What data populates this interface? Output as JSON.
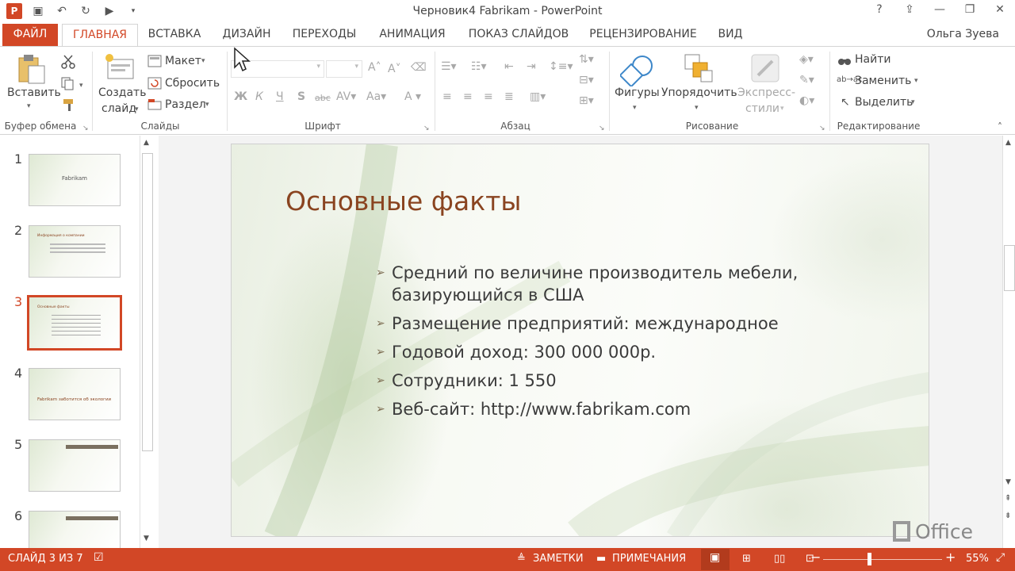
{
  "window": {
    "title": "Черновик4 Fabrikam - PowerPoint",
    "help": "?",
    "controls": [
      "ribbon-display",
      "minimize",
      "restore",
      "close"
    ]
  },
  "qat": {
    "app_icon": "P",
    "items": [
      "save-icon",
      "undo-icon",
      "redo-icon",
      "slideshow-icon",
      "customize-icon"
    ]
  },
  "tabs": [
    "ФАЙЛ",
    "ГЛАВНАЯ",
    "ВСТАВКА",
    "ДИЗАЙН",
    "ПЕРЕХОДЫ",
    "АНИМАЦИЯ",
    "ПОКАЗ СЛАЙДОВ",
    "РЕЦЕНЗИРОВАНИЕ",
    "ВИД"
  ],
  "user": "Ольга Зуева",
  "ribbon": {
    "clipboard": {
      "label": "Буфер обмена",
      "paste": "Вставить"
    },
    "slides": {
      "label": "Слайды",
      "new_slide_1": "Создать",
      "new_slide_2": "слайд",
      "layout": "Макет",
      "reset": "Сбросить",
      "section": "Раздел"
    },
    "font": {
      "label": "Шрифт",
      "bold": "Ж",
      "italic": "К",
      "underline": "Ч",
      "shadow": "S",
      "strike": "abc"
    },
    "paragraph": {
      "label": "Абзац"
    },
    "drawing": {
      "label": "Рисование",
      "shapes": "Фигуры",
      "arrange": "Упорядочить",
      "quick_styles_1": "Экспресс-",
      "quick_styles_2": "стили"
    },
    "editing": {
      "label": "Редактирование",
      "find": "Найти",
      "replace": "Заменить",
      "select": "Выделить"
    }
  },
  "thumbnails": [
    {
      "num": "1",
      "text": "Fabrikam"
    },
    {
      "num": "2",
      "text": "Информация о компании"
    },
    {
      "num": "3",
      "text": "Основные факты"
    },
    {
      "num": "4",
      "text": "Fabrikam заботится об экологии"
    },
    {
      "num": "5",
      "text": ""
    },
    {
      "num": "6",
      "text": ""
    }
  ],
  "slide": {
    "title": "Основные факты",
    "bullets": [
      "Средний по величине производитель мебели, базирующийся в США",
      "Размещение предприятий: международное",
      "Годовой доход: 300 000 000р.",
      "Сотрудники: 1 550",
      "Веб-сайт: http://www.fabrikam.com"
    ]
  },
  "status": {
    "slide_info": "СЛАЙД 3 ИЗ 7",
    "notes": "ЗАМЕТКИ",
    "comments": "ПРИМЕЧАНИЯ",
    "zoom": "55%",
    "zoom_fraction": 0.55
  },
  "watermark": "Office",
  "colors": {
    "accent": "#d24726",
    "title": "#8a4420"
  }
}
